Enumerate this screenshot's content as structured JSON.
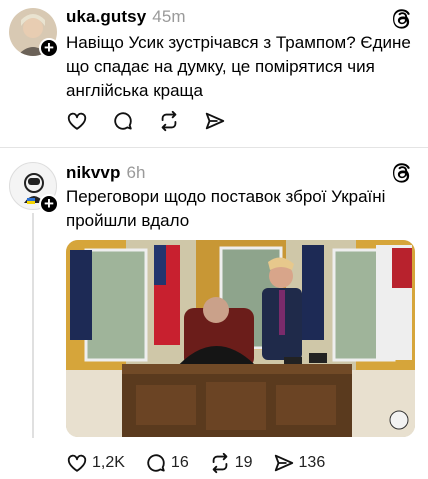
{
  "posts": [
    {
      "username": "uka.gutsy",
      "time": "45m",
      "text": "Навіщо Усик зустрічався з Трампом? Єдине що спадає на думку, це помірятися чия англійська краща",
      "actions": {
        "like": "",
        "comment": "",
        "repost": "",
        "share": ""
      }
    },
    {
      "username": "nikvvp",
      "time": "6h",
      "text": "Переговори щодо поставок зброї Україні пройшли вдало",
      "actions": {
        "like": "1,2K",
        "comment": "16",
        "repost": "19",
        "share": "136"
      }
    }
  ],
  "icons": [
    "plus-icon",
    "threads-icon",
    "heart-icon",
    "comment-icon",
    "repost-icon",
    "share-icon"
  ],
  "colors": {
    "text": "#000000",
    "muted": "#9a9a9a",
    "divider": "#e4e4e4"
  }
}
